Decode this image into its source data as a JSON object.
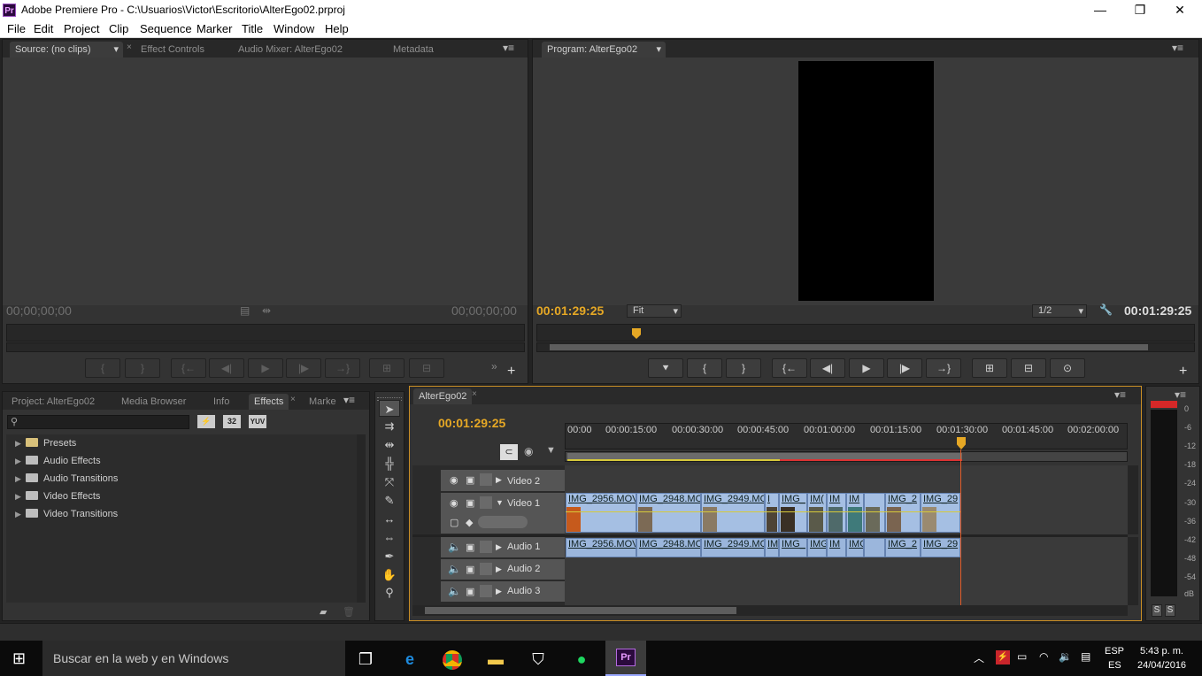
{
  "window": {
    "title": "Adobe Premiere Pro - C:\\Usuarios\\Victor\\Escritorio\\AlterEgo02.prproj",
    "logo": "Pr",
    "minimize": "—",
    "maximize": "❐",
    "close": "✕"
  },
  "menu": [
    "File",
    "Edit",
    "Project",
    "Clip",
    "Sequence",
    "Marker",
    "Title",
    "Window",
    "Help"
  ],
  "source": {
    "tabs": [
      "Source: (no clips)",
      "Effect Controls",
      "Audio Mixer: AlterEgo02",
      "Metadata"
    ],
    "timecode_left": "00;00;00;00",
    "timecode_right": "00;00;00;00"
  },
  "program": {
    "tab": "Program: AlterEgo02",
    "timecode": "00:01:29:25",
    "fit": "Fit",
    "resolution": "1/2",
    "duration": "00:01:29:25"
  },
  "project": {
    "tabs": [
      "Project: AlterEgo02",
      "Media Browser",
      "Info",
      "Effects",
      "Marke"
    ],
    "search_value": "",
    "filter_badges": [
      "32",
      "YUV"
    ],
    "tree": [
      "Presets",
      "Audio Effects",
      "Audio Transitions",
      "Video Effects",
      "Video Transitions"
    ]
  },
  "timeline": {
    "tab": "AlterEgo02",
    "timecode": "00:01:29:25",
    "ruler": [
      "00:00",
      "00:00:15:00",
      "00:00:30:00",
      "00:00:45:00",
      "00:01:00:00",
      "00:01:15:00",
      "00:01:30:00",
      "00:01:45:00",
      "00:02:00:00"
    ],
    "tracks": {
      "video2": "Video 2",
      "video1": "Video 1",
      "audio1": "Audio 1",
      "audio2": "Audio 2",
      "audio3": "Audio 3"
    },
    "video_clips": [
      "IMG_2956.MOV",
      "IMG_2948.MO",
      "IMG_2949.MO",
      "I",
      "IMG_",
      "IM(",
      "IM",
      "IM",
      "IMG_2",
      "IMG_29"
    ],
    "audio_clips": [
      "IMG_2956.MOV",
      "IMG_2948.MO",
      "IMG_2949.MO",
      "IM",
      "IMG_",
      "IMG",
      "IM",
      "IMG",
      "IMG_2",
      "IMG_29"
    ]
  },
  "meter": {
    "labels": [
      "0",
      "-6",
      "-12",
      "-18",
      "-24",
      "-30",
      "-36",
      "-42",
      "-48",
      "-54",
      "dB"
    ],
    "solo": [
      "S",
      "S"
    ]
  },
  "taskbar": {
    "search_placeholder": "Buscar en la web y en Windows",
    "lang_top": "ESP",
    "lang_bottom": "ES",
    "time": "5:43 p. m.",
    "date": "24/04/2016"
  },
  "colors": {
    "accent": "#e6a825",
    "clip_blue": "#9bb6dc",
    "playhead": "#e25d2a"
  }
}
